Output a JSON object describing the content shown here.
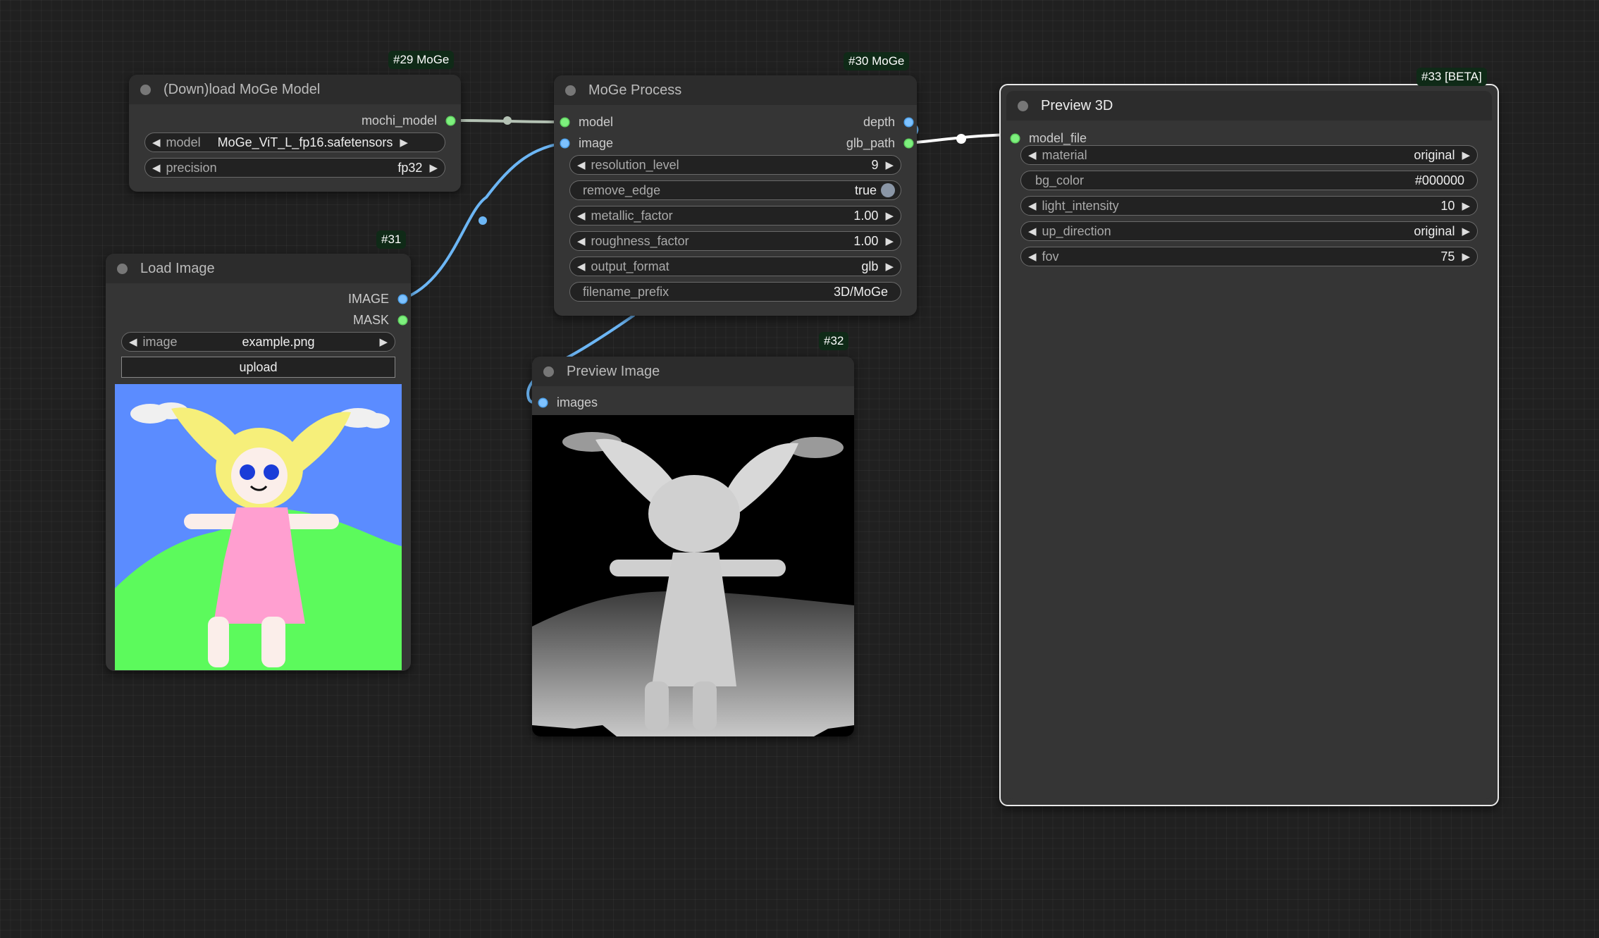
{
  "nodes": {
    "load_moge": {
      "id_badge": "#29 MoGe",
      "title": "(Down)load MoGe Model",
      "outputs": [
        "mochi_model"
      ],
      "widgets": [
        {
          "label": "model",
          "value": "MoGe_ViT_L_fp16.safetensors"
        },
        {
          "label": "precision",
          "value": "fp32"
        }
      ]
    },
    "load_image": {
      "id_badge": "#31",
      "title": "Load Image",
      "outputs": [
        "IMAGE",
        "MASK"
      ],
      "widgets": [
        {
          "label": "image",
          "value": "example.png"
        }
      ],
      "upload_label": "upload"
    },
    "moge_process": {
      "id_badge": "#30 MoGe",
      "title": "MoGe Process",
      "inputs": [
        "model",
        "image"
      ],
      "outputs": [
        "depth",
        "glb_path"
      ],
      "widgets": [
        {
          "label": "resolution_level",
          "value": "9"
        },
        {
          "label": "remove_edge",
          "value": "true"
        },
        {
          "label": "metallic_factor",
          "value": "1.00"
        },
        {
          "label": "roughness_factor",
          "value": "1.00"
        },
        {
          "label": "output_format",
          "value": "glb"
        },
        {
          "label": "filename_prefix",
          "value": "3D/MoGe"
        }
      ]
    },
    "preview_image": {
      "id_badge": "#32",
      "title": "Preview Image",
      "inputs": [
        "images"
      ]
    },
    "preview_3d": {
      "id_badge": "#33 [BETA]",
      "title": "Preview 3D",
      "inputs": [
        "model_file"
      ],
      "widgets": [
        {
          "label": "material",
          "value": "original"
        },
        {
          "label": "bg_color",
          "value": "#000000"
        },
        {
          "label": "light_intensity",
          "value": "10"
        },
        {
          "label": "up_direction",
          "value": "original"
        },
        {
          "label": "fov",
          "value": "75"
        }
      ]
    }
  },
  "colors": {
    "canvas": "#202020",
    "node_body": "#353535",
    "node_header": "#2c2c2c",
    "badge": "#0f2a17",
    "wire_image": "#6cb6f5",
    "wire_model": "#b4c2b4",
    "wire_string": "#ffffff",
    "slot_green": "#7ef07e",
    "slot_blue": "#7ec2ff"
  },
  "icons": {
    "decrement": "left-arrow-icon",
    "increment": "right-arrow-icon",
    "collapse": "collapse-dot-icon",
    "toggle": "toggle-knob-icon"
  }
}
